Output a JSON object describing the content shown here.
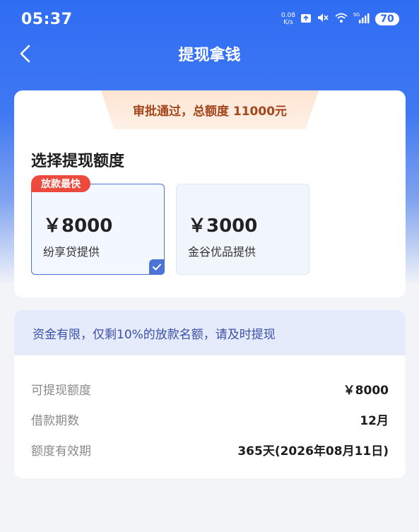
{
  "status_bar": {
    "time": "05:37",
    "net_speed_value": "0.08",
    "net_speed_unit": "K/s",
    "network": "5G",
    "battery": "70",
    "icons": [
      "notification-icon",
      "mute-icon",
      "wifi-icon",
      "signal-icon"
    ]
  },
  "nav": {
    "back_icon": "chevron-left-icon",
    "title": "提现拿钱"
  },
  "approval": {
    "text": "审批通过，总额度 11000元"
  },
  "amount_select": {
    "title": "选择提现额度",
    "badge": "放款最快",
    "options": [
      {
        "amount": "￥8000",
        "provider": "纷享贷提供",
        "selected": true
      },
      {
        "amount": "￥3000",
        "provider": "金谷优品提供",
        "selected": false
      }
    ]
  },
  "details": {
    "notice": "资金有限，仅剩10%的放款名额，请及时提现",
    "rows": [
      {
        "label": "可提现额度",
        "value": "￥8000"
      },
      {
        "label": "借款期数",
        "value": "12月"
      },
      {
        "label": "额度有效期",
        "value": "365天(2026年08月11日)"
      }
    ]
  },
  "colors": {
    "brand_blue": "#2f6df3",
    "badge_red": "#ec4a3c",
    "approval_text": "#a3461c",
    "notice_text": "#3a4fa8"
  }
}
